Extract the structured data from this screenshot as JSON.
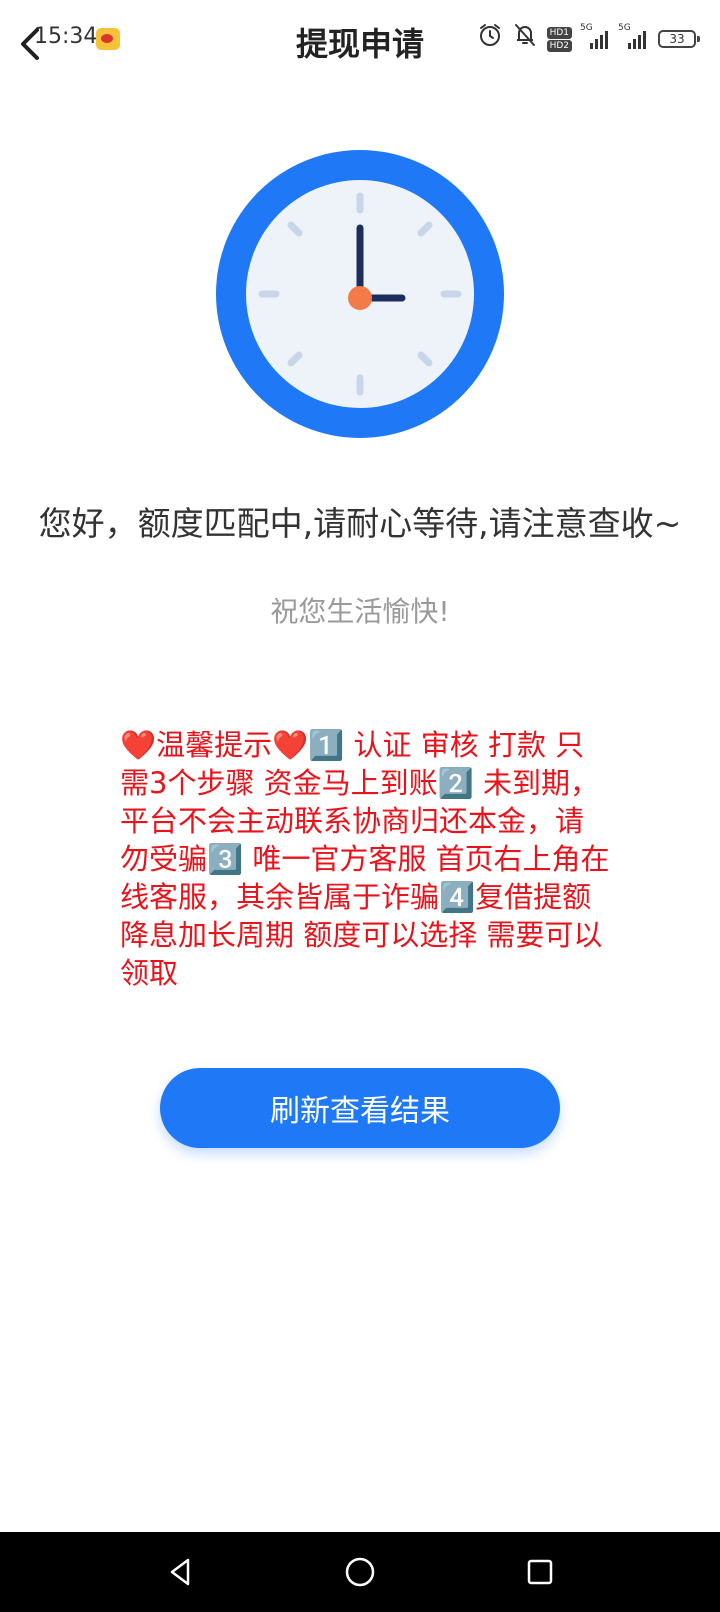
{
  "status_bar": {
    "time": "15:34",
    "app_icon": "weibo-icon",
    "icons": [
      "alarm-icon",
      "bell-off-icon",
      "hd-icon",
      "signal-5g-icon",
      "signal-5g-icon",
      "battery-icon"
    ],
    "hd_label_1": "HD1",
    "hd_label_2": "HD2",
    "network_1": "5G",
    "network_2": "5G",
    "battery_level": "33"
  },
  "header": {
    "title": "提现申请",
    "back_icon": "chevron-left-icon"
  },
  "illustration": {
    "icon": "clock-icon",
    "ring_color": "#1f78f5",
    "face_color": "#eef3fa",
    "hand_color": "#1c2e5c",
    "center_color": "#f47a48"
  },
  "main": {
    "greeting": "您好，额度匹配中,请耐心等待,请注意查收~",
    "wish": "祝您生活愉快!",
    "tips": "❤️温馨提示❤️1️⃣ 认证 审核 打款 只需3个步骤 资金马上到账2️⃣ 未到期，平台不会主动联系协商归还本金，请勿受骗3️⃣ 唯一官方客服 首页右上角在线客服，其余皆属于诈骗4️⃣复借提额降息加长周期 额度可以选择 需要可以领取",
    "tips_color": "#e8141b"
  },
  "actions": {
    "refresh_label": "刷新查看结果",
    "accent": "#1f78f5"
  },
  "nav_bar": {
    "back_icon": "triangle-back-icon",
    "home_icon": "circle-home-icon",
    "recents_icon": "square-recents-icon"
  }
}
